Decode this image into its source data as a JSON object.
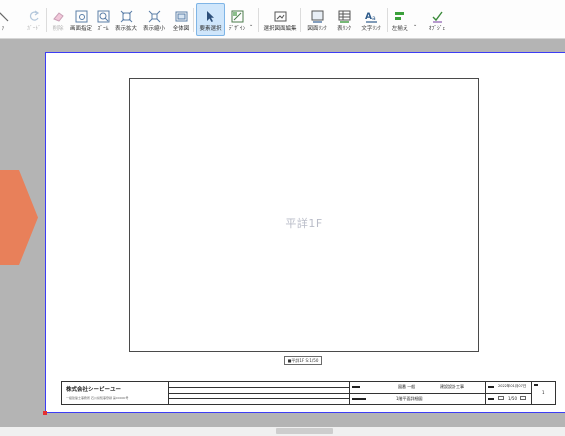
{
  "toolbar": {
    "buttons": [
      {
        "label": "ｧ",
        "icon": "partial-cut-icon",
        "disabled": false
      },
      {
        "label": "ｶﾞｰﾄﾞ",
        "icon": "redo-icon",
        "disabled": true
      },
      {
        "label": "削除",
        "icon": "eraser-icon",
        "disabled": true
      },
      {
        "label": "画面指定",
        "icon": "zoom-select-icon",
        "disabled": false
      },
      {
        "label": "ｽﾞｰﾑ",
        "icon": "zoom-icon",
        "disabled": false
      },
      {
        "label": "表示拡大",
        "icon": "zoom-in-icon",
        "disabled": false
      },
      {
        "label": "表示縮小",
        "icon": "zoom-out-icon",
        "disabled": false
      },
      {
        "label": "全体図",
        "icon": "fit-all-icon",
        "disabled": false
      },
      {
        "label": "要素選択",
        "icon": "select-cursor-icon",
        "disabled": false,
        "active": true
      },
      {
        "label": "ﾃﾞｻﾞｲﾝ",
        "icon": "design-icon",
        "disabled": false,
        "dropdown": true
      },
      {
        "label": "選択図面編集",
        "icon": "edit-drawing-icon",
        "disabled": false
      },
      {
        "label": "図面ﾘﾝｸ",
        "icon": "drawing-link-icon",
        "disabled": false
      },
      {
        "label": "表ﾘﾝｸ",
        "icon": "table-link-icon",
        "disabled": false
      },
      {
        "label": "文字ﾘﾝｸ",
        "icon": "text-link-icon",
        "disabled": false
      },
      {
        "label": "左揃え",
        "icon": "align-left-icon",
        "disabled": false,
        "dropdown": true
      },
      {
        "label": "ｵﾌﾞｼﾞｪ",
        "icon": "object-snap-icon",
        "disabled": false
      }
    ]
  },
  "drawing": {
    "view_name": "平詳1F",
    "view_caption": "■平詳1F S:1/50"
  },
  "title_block": {
    "company": "株式会社シーピーユー",
    "company_sub": "一級建築士事務所 石川県知事登録 第00000号",
    "drawing_no_label": "図番 一般",
    "project": "建設設計工事",
    "date": "2022年01月07日",
    "drawing_title": "1階平面詳細図",
    "scale": "1/50",
    "sheet_no": "1"
  },
  "colors": {
    "accent_active": "#cfe6fb",
    "paper_border": "#3d3df5",
    "arrow": "#e8805a",
    "view_name_text": "#b9bcc8"
  }
}
